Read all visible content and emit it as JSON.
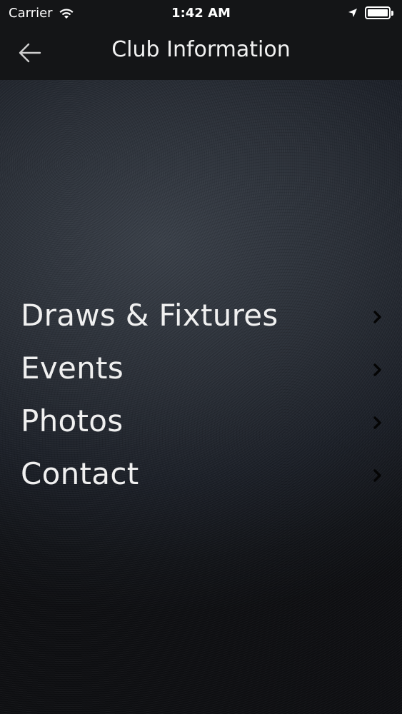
{
  "status_bar": {
    "carrier": "Carrier",
    "time": "1:42 AM",
    "icons": [
      "wifi-icon",
      "location-icon",
      "battery-icon"
    ]
  },
  "nav": {
    "title": "Club Information",
    "back_icon": "back-arrow-icon"
  },
  "menu": {
    "items": [
      {
        "label": "Draws & Fixtures",
        "icon": "chevron-right-icon"
      },
      {
        "label": "Events",
        "icon": "chevron-right-icon"
      },
      {
        "label": "Photos",
        "icon": "chevron-right-icon"
      },
      {
        "label": "Contact",
        "icon": "chevron-right-icon"
      }
    ]
  },
  "colors": {
    "bar_background": "#141517",
    "text": "#f0f0f0",
    "chevron": "#0a0a0a"
  }
}
